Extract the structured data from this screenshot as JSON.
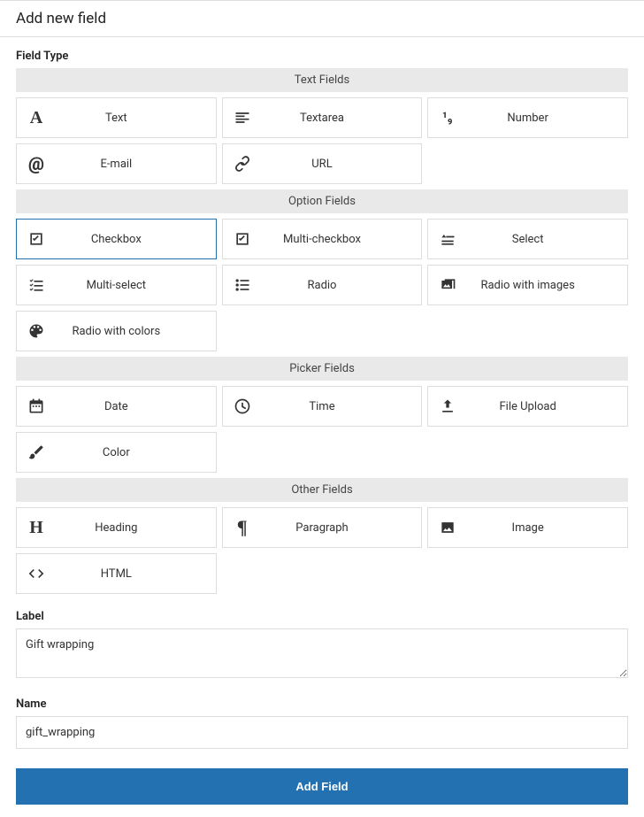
{
  "header": {
    "title": "Add new field"
  },
  "fieldTypeLabel": "Field Type",
  "sections": {
    "text": "Text Fields",
    "option": "Option Fields",
    "picker": "Picker Fields",
    "other": "Other Fields"
  },
  "fields": {
    "text": "Text",
    "textarea": "Textarea",
    "number": "Number",
    "email": "E-mail",
    "url": "URL",
    "checkbox": "Checkbox",
    "multiCheckbox": "Multi-checkbox",
    "select": "Select",
    "multiSelect": "Multi-select",
    "radio": "Radio",
    "radioImages": "Radio with images",
    "radioColors": "Radio with colors",
    "date": "Date",
    "time": "Time",
    "fileUpload": "File Upload",
    "color": "Color",
    "heading": "Heading",
    "paragraph": "Paragraph",
    "image": "Image",
    "html": "HTML"
  },
  "form": {
    "labelLabel": "Label",
    "labelValue": "Gift wrapping",
    "nameLabel": "Name",
    "nameValue": "gift_wrapping",
    "submitLabel": "Add Field"
  },
  "selected": "checkbox"
}
